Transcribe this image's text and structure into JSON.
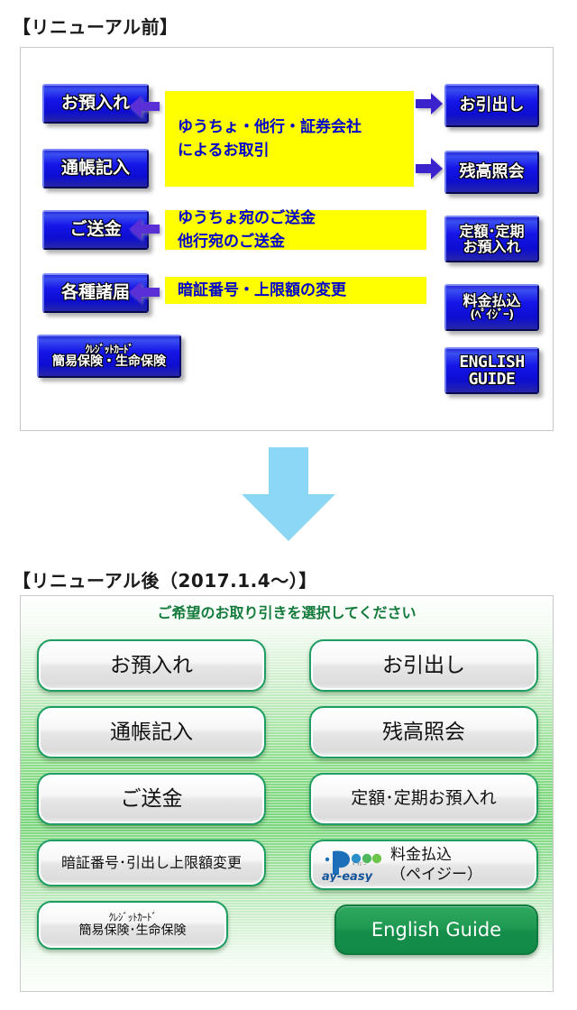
{
  "headings": {
    "before": "【リニューアル前】",
    "after": "【リニューアル後（2017.1.4〜）】"
  },
  "before_panel": {
    "left_buttons": [
      {
        "name": "deposit",
        "label": "お預入れ"
      },
      {
        "name": "passbook",
        "label": "通帳記入"
      },
      {
        "name": "transfer",
        "label": "ご送金"
      },
      {
        "name": "notices",
        "label": "各種諸届"
      }
    ],
    "credit_button": {
      "line1": "ｸﾚｼﾞｯﾄｶｰﾄﾞ",
      "line2": "簡易保険・生命保険"
    },
    "right_buttons": [
      {
        "name": "withdraw",
        "label": "お引出し"
      },
      {
        "name": "balance",
        "label": "残高照会"
      }
    ],
    "fixed_button": {
      "line1": "定額･定期",
      "line2": "お預入れ"
    },
    "payeasy_button": {
      "line1": "料金払込",
      "line2": "(ﾍﾟｲｼﾞｰ)"
    },
    "english_button": {
      "line1": "ENGLISH",
      "line2": "GUIDE"
    },
    "callouts": {
      "transactions": {
        "line1": "ゆうちょ・他行・証券会社",
        "line2": "によるお取引"
      },
      "remittance": {
        "line1": "ゆうちょ宛のご送金",
        "line2": "他行宛のご送金"
      },
      "pin": {
        "line1": "暗証番号・上限額の変更"
      }
    }
  },
  "after_panel": {
    "header": "ご希望のお取り引きを選択してください",
    "left_buttons": [
      {
        "name": "deposit",
        "label": "お預入れ"
      },
      {
        "name": "passbook",
        "label": "通帳記入"
      },
      {
        "name": "transfer",
        "label": "ご送金"
      },
      {
        "name": "pin",
        "label": "暗証番号･引出し上限額変更"
      }
    ],
    "credit_button": {
      "line1": "ｸﾚｼﾞｯﾄｶｰﾄﾞ",
      "line2": "簡易保険･生命保険"
    },
    "right_buttons": [
      {
        "name": "withdraw",
        "label": "お引出し"
      },
      {
        "name": "balance",
        "label": "残高照会"
      },
      {
        "name": "fixed",
        "label": "定額･定期お預入れ"
      }
    ],
    "payeasy_button": {
      "logo_text": "Pay-easy",
      "logo_ruby": "ﾍﾟｲｼﾞｰ",
      "line1": "料金払込",
      "line2": "（ペイジー）"
    },
    "english_button": {
      "label": "English Guide"
    }
  },
  "colors": {
    "old_button_blue": "#1616e8",
    "callout_yellow": "#ffff00",
    "callout_text_blue": "#0000cc",
    "arrow_purple": "#5b2fd6",
    "big_arrow_cyan": "#8ad8f5",
    "atm_green": "#1e9e62",
    "header_green": "#137a3b",
    "english_green": "#1f9a52"
  }
}
